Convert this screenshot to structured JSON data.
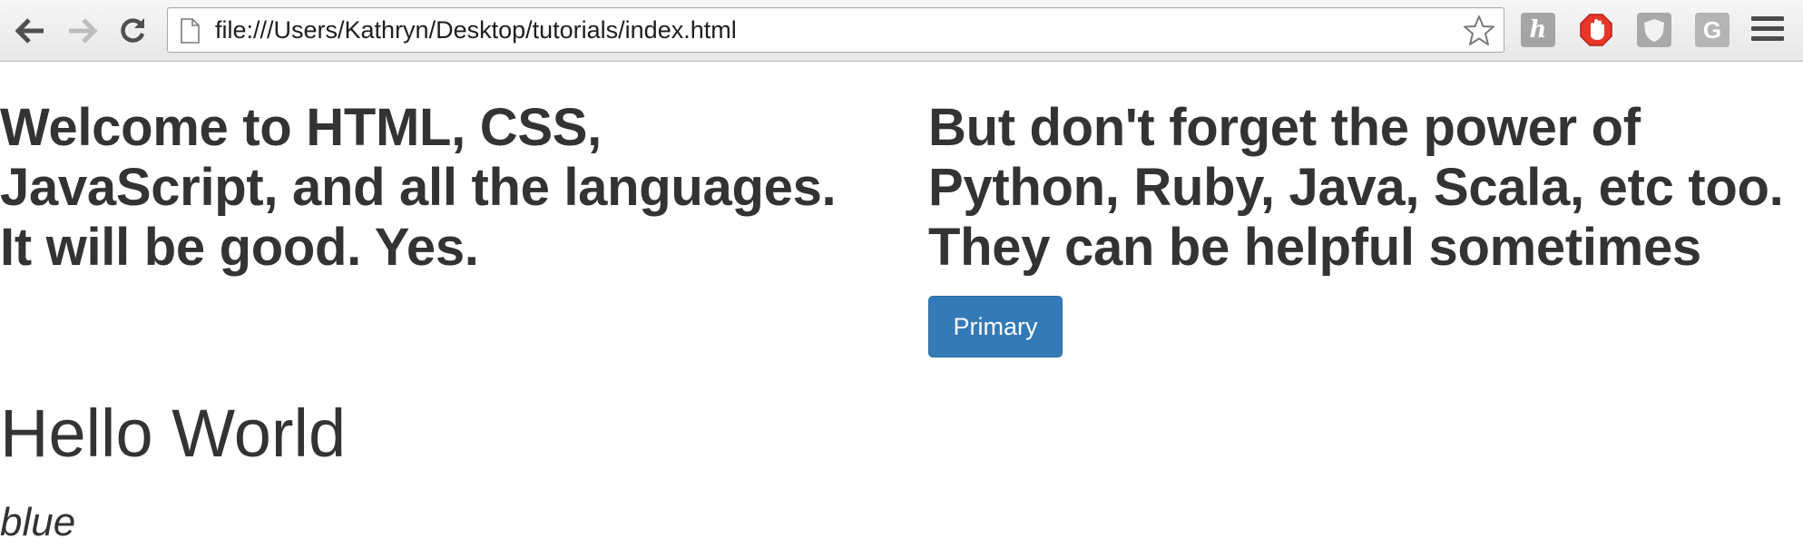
{
  "browser": {
    "url": "file:///Users/Kathryn/Desktop/tutorials/index.html",
    "icons": {
      "back": "back-arrow-icon",
      "forward": "forward-arrow-icon",
      "reload": "reload-icon",
      "page": "page-icon",
      "bookmark": "star-icon",
      "menu": "hamburger-menu-icon"
    },
    "extensions": [
      {
        "name": "h-extension-icon",
        "glyph": "h"
      },
      {
        "name": "adblock-hand-icon"
      },
      {
        "name": "shield-extension-icon"
      },
      {
        "name": "grammarly-icon",
        "glyph": "G"
      }
    ]
  },
  "page": {
    "left_heading_lines": [
      "Welcome to HTML, CSS,",
      "JavaScript, and all the languages.",
      "It will be good. Yes."
    ],
    "right_heading_lines": [
      "But don't forget the power of",
      "Python, Ruby, Java, Scala, etc too.",
      "They can be helpful sometimes"
    ],
    "primary_button_label": "Primary",
    "hello_heading": "Hello World",
    "blue_text": "blue"
  },
  "colors": {
    "primary_button_bg": "#337ab7",
    "text": "#333333",
    "adblock_red": "#e8362b"
  }
}
